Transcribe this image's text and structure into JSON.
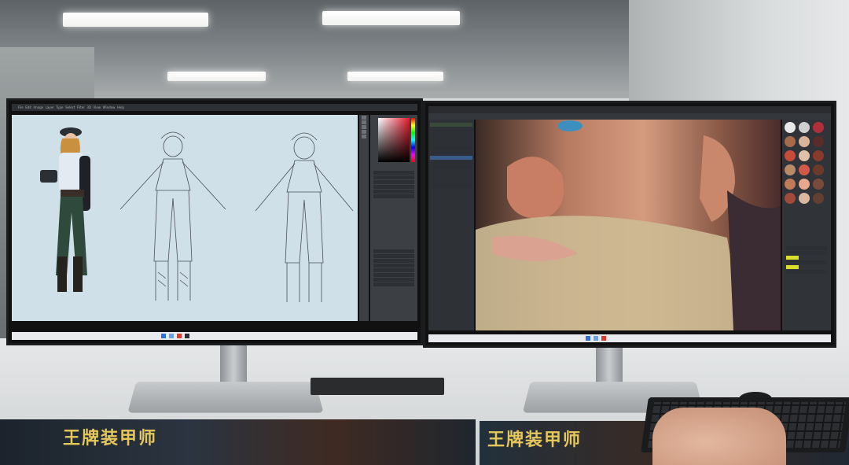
{
  "scene": {
    "description_free": true
  },
  "left_monitor": {
    "app": "photoshop",
    "menu_items": [
      "File",
      "Edit",
      "Image",
      "Layer",
      "Type",
      "Select",
      "Filter",
      "3D",
      "View",
      "Window",
      "Help"
    ],
    "icons": [
      "brush-icon",
      "eraser-icon",
      "move-icon",
      "zoom-icon",
      "hand-icon"
    ]
  },
  "right_monitor": {
    "app": "3d-sculpting",
    "panel_rows": 14,
    "material_spheres": 18
  },
  "mousepad": {
    "title_left": "王牌装甲师",
    "title_right": "王牌装甲师"
  },
  "colors": {
    "photoshop_bg": "#3c3f44",
    "canvas_bg": "#cfe0e8",
    "color_picker_red": "#e31b2d",
    "taskbar": "#e8eaee",
    "pad_text": "#e6c85a"
  }
}
